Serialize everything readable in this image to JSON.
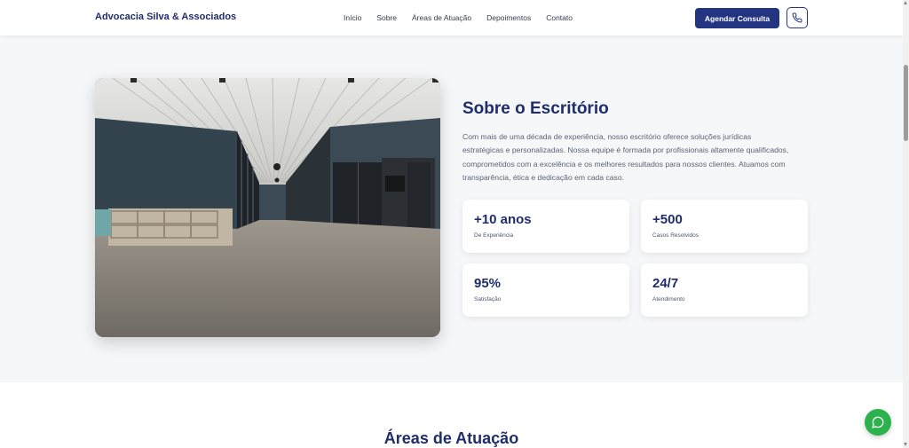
{
  "header": {
    "brand": "Advocacia Silva & Associados",
    "nav": [
      "Início",
      "Sobre",
      "Áreas de Atuação",
      "Depoimentos",
      "Contato"
    ],
    "cta": "Agendar Consulta",
    "phone_icon": "phone-icon"
  },
  "about": {
    "title": "Sobre o Escritório",
    "text": "Com mais de uma década de experiência, nosso escritório oferece soluções jurídicas estratégicas e personalizadas. Nossa equipe é formada por profissionais altamente qualificados, comprometidos com a excelência e os melhores resultados para nossos clientes. Atuamos com transparência, ética e dedicação em cada caso.",
    "stats": [
      {
        "value": "+10 anos",
        "label": "De Experiência"
      },
      {
        "value": "+500",
        "label": "Casos Resolvidos"
      },
      {
        "value": "95%",
        "label": "Satisfação"
      },
      {
        "value": "24/7",
        "label": "Atendimento"
      }
    ]
  },
  "areas": {
    "title": "Áreas de Atuação"
  },
  "floating": {
    "whatsapp_icon": "whatsapp-icon"
  },
  "colors": {
    "primary": "#233580",
    "heading": "#1f2d6b",
    "whatsapp": "#2bb24c",
    "background": "#f6f7f9"
  }
}
